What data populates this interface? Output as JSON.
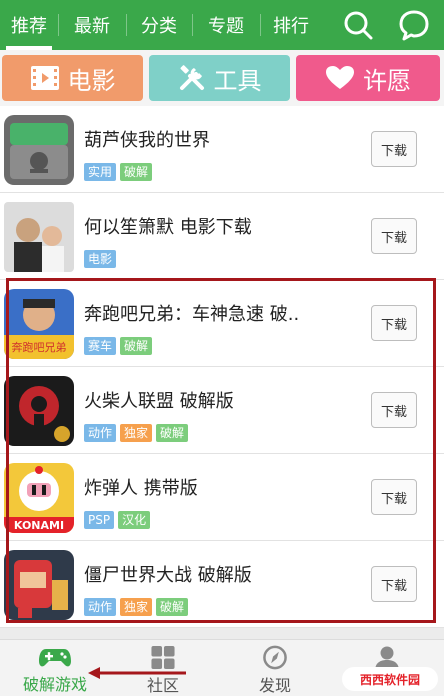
{
  "colors": {
    "brand_green": "#3aa84a",
    "highlight_red": "#a5171b"
  },
  "topnav": {
    "tabs": [
      {
        "label": "推荐",
        "active": true
      },
      {
        "label": "最新"
      },
      {
        "label": "分类"
      },
      {
        "label": "专题"
      },
      {
        "label": "排行"
      }
    ],
    "icons": [
      "search-icon",
      "chat-bubble-icon"
    ]
  },
  "categories": [
    {
      "label": "电影",
      "icon": "film-icon",
      "color": "#f19b6b"
    },
    {
      "label": "工具",
      "icon": "tools-icon",
      "color": "#7fd0c8"
    },
    {
      "label": "许愿",
      "icon": "heart-icon",
      "color": "#f05a8c"
    }
  ],
  "apps": [
    {
      "title": "葫芦侠我的世界",
      "tags": [
        "实用",
        "破解"
      ],
      "download": "下载"
    },
    {
      "title": "何以笙箫默  电影下载",
      "tags": [
        "电影"
      ],
      "download": "下载"
    },
    {
      "title": "奔跑吧兄弟：车神急速  破..",
      "tags": [
        "赛车",
        "破解"
      ],
      "download": "下载",
      "icon_text": "奔跑吧兄弟"
    },
    {
      "title": "火柴人联盟  破解版",
      "tags": [
        "动作",
        "独家",
        "破解"
      ],
      "download": "下载"
    },
    {
      "title": "炸弹人  携带版",
      "tags": [
        "PSP",
        "汉化"
      ],
      "download": "下载",
      "icon_text": "KONAMI"
    },
    {
      "title": "僵尸世界大战  破解版",
      "tags": [
        "动作",
        "独家",
        "破解"
      ],
      "download": "下载"
    }
  ],
  "tag_colors": {
    "实用": "#7ab8e8",
    "破解": "#7ccd7c",
    "电影": "#7ab8e8",
    "赛车": "#7ab8e8",
    "动作": "#7ab8e8",
    "独家": "#f6a04d",
    "PSP": "#7ab8e8",
    "汉化": "#7ccd7c"
  },
  "bottomnav": [
    {
      "label": "破解游戏",
      "active": true
    },
    {
      "label": "社区"
    },
    {
      "label": "发现"
    },
    {
      "label": ""
    }
  ],
  "watermark": "西西软件园"
}
